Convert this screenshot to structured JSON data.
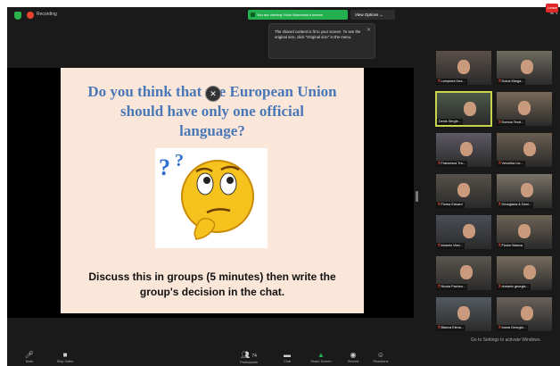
{
  "topbar": {
    "recording_label": "Recording",
    "share_banner": "You are viewing Victor Munteanu's screen",
    "view_options": "View Options ⌄",
    "gallery_toggle": "☰ V"
  },
  "tooltip": {
    "text": "The shared content is fit to your screen. To see the original size, click \"Original size\" in the menu.",
    "close": "✕"
  },
  "slide": {
    "question": "Do you think that the European Union should have only one official language?",
    "instruction": "Discuss this in groups (5 minutes) then write the group's decision in the chat.",
    "emoji": "thinking-face-with-question-marks"
  },
  "gallery": {
    "participants": [
      {
        "name": "Lampnea Dea...",
        "mic_muted": true
      },
      {
        "name": "Doina Marga...",
        "mic_muted": true
      },
      {
        "name": "Denis Sergie...",
        "mic_muted": false,
        "active_speaker": true
      },
      {
        "name": "Dumoa Teod...",
        "mic_muted": true
      },
      {
        "name": "Francesca Tra...",
        "mic_muted": true
      },
      {
        "name": "Veronika Lio...",
        "mic_muted": true
      },
      {
        "name": "Florea Eduard",
        "mic_muted": true
      },
      {
        "name": "Georgiana & Dani...",
        "mic_muted": true
      },
      {
        "name": "Iduaniu Vlad...",
        "mic_muted": true
      },
      {
        "name": "Flodor Bianca",
        "mic_muted": true
      },
      {
        "name": "Nicola Pacheo...",
        "mic_muted": true
      },
      {
        "name": "chelariu georgia...",
        "mic_muted": true
      },
      {
        "name": "Bianca Elena...",
        "mic_muted": true
      },
      {
        "name": "Ioana Georgia...",
        "mic_muted": true
      }
    ]
  },
  "watermark": "Go to Settings to activate Windows.",
  "toolbar": {
    "mute": "Mute",
    "stop_video": "Stop Video",
    "participants": "Participants",
    "participants_count": "74",
    "chat": "Chat",
    "share_screen": "Share Screen",
    "record": "Record",
    "reactions": "Reactions",
    "leave": "Leave"
  },
  "colors": {
    "share_banner": "#24b04e",
    "slide_bg": "#fbe6da",
    "question_text": "#4a78b6",
    "active_speaker_border": "#c8d44a",
    "leave_button": "#e02828"
  }
}
